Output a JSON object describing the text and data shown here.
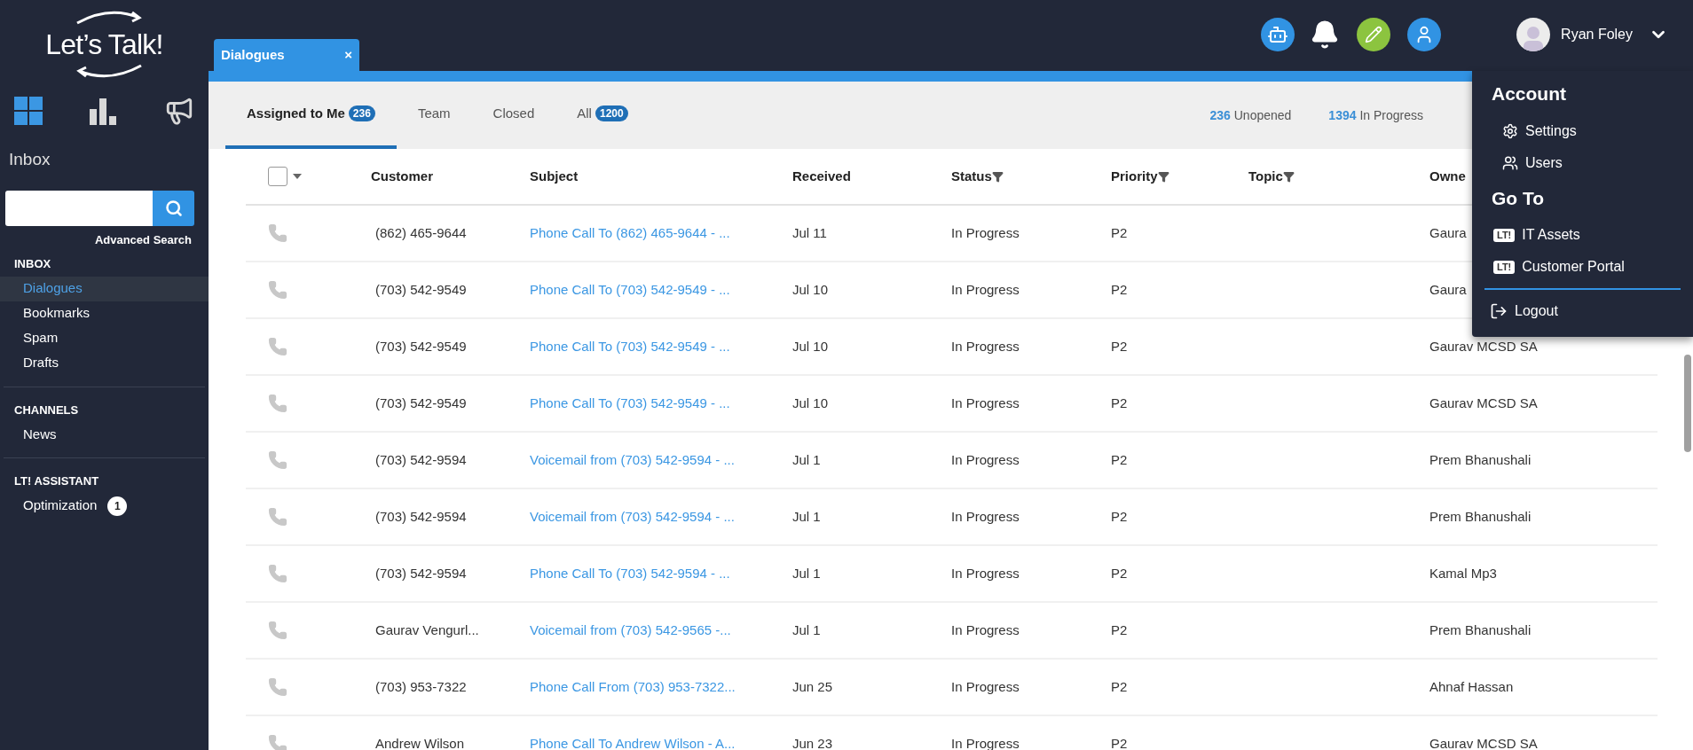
{
  "logo": {
    "text": "Let’s Talk!"
  },
  "nav_icons": [
    {
      "kind": "grid",
      "selected": true
    },
    {
      "kind": "chart",
      "selected": false
    },
    {
      "kind": "megaphone",
      "selected": false
    }
  ],
  "sidebar": {
    "title": "Inbox",
    "advanced_search": "Advanced Search",
    "sections": [
      {
        "heading": "INBOX",
        "items": [
          {
            "label": "Dialogues",
            "selected": true
          },
          {
            "label": "Bookmarks",
            "selected": false
          },
          {
            "label": "Spam",
            "selected": false
          },
          {
            "label": "Drafts",
            "selected": false
          }
        ]
      },
      {
        "heading": "CHANNELS",
        "items": [
          {
            "label": "News",
            "selected": false
          }
        ]
      },
      {
        "heading": "LT! ASSISTANT",
        "items": [
          {
            "label": "Optimization",
            "selected": false,
            "count": "1"
          }
        ]
      }
    ]
  },
  "user": {
    "name": "Ryan Foley"
  },
  "window_tab": {
    "title": "Dialogues",
    "close": "×"
  },
  "tabs": [
    {
      "label": "Assigned to Me",
      "count": "236",
      "selected": true
    },
    {
      "label": "Team",
      "selected": false
    },
    {
      "label": "Closed",
      "selected": false
    },
    {
      "label": "All",
      "count": "1200",
      "selected": false
    }
  ],
  "stats": [
    {
      "value": "236",
      "label": "Unopened"
    },
    {
      "value": "1394",
      "label": "In Progress"
    }
  ],
  "table": {
    "select_all": {
      "checked": false
    },
    "columns": [
      {
        "label": "Customer",
        "filter": false
      },
      {
        "label": "Subject",
        "filter": false
      },
      {
        "label": "Received",
        "filter": false
      },
      {
        "label": "Status",
        "filter": true
      },
      {
        "label": "Priority",
        "filter": true
      },
      {
        "label": "Topic",
        "filter": true
      },
      {
        "label": "Owne",
        "filter": false
      }
    ],
    "rows": [
      {
        "customer": "(862) 465-9644",
        "subject": "Phone Call To (862) 465-9644 - ...",
        "received": "Jul 11",
        "status": "In Progress",
        "priority": "P2",
        "owner": "Gaura"
      },
      {
        "customer": "(703) 542-9549",
        "subject": "Phone Call To (703) 542-9549 - ...",
        "received": "Jul 10",
        "status": "In Progress",
        "priority": "P2",
        "owner": "Gaura"
      },
      {
        "customer": "(703) 542-9549",
        "subject": "Phone Call To (703) 542-9549 - ...",
        "received": "Jul 10",
        "status": "In Progress",
        "priority": "P2",
        "owner": "Gaurav MCSD SA"
      },
      {
        "customer": "(703) 542-9549",
        "subject": "Phone Call To (703) 542-9549 - ...",
        "received": "Jul 10",
        "status": "In Progress",
        "priority": "P2",
        "owner": "Gaurav MCSD SA"
      },
      {
        "customer": "(703) 542-9594",
        "subject": "Voicemail from (703) 542-9594 - ...",
        "received": "Jul 1",
        "status": "In Progress",
        "priority": "P2",
        "owner": "Prem Bhanushali"
      },
      {
        "customer": "(703) 542-9594",
        "subject": "Voicemail from (703) 542-9594 - ...",
        "received": "Jul 1",
        "status": "In Progress",
        "priority": "P2",
        "owner": "Prem Bhanushali"
      },
      {
        "customer": "(703) 542-9594",
        "subject": "Phone Call To (703) 542-9594 - ...",
        "received": "Jul 1",
        "status": "In Progress",
        "priority": "P2",
        "owner": "Kamal Mp3"
      },
      {
        "customer": "Gaurav Vengurl...",
        "subject": "Voicemail from (703) 542-9565 -...",
        "received": "Jul 1",
        "status": "In Progress",
        "priority": "P2",
        "owner": "Prem Bhanushali"
      },
      {
        "customer": "(703) 953-7322",
        "subject": "Phone Call From (703) 953-7322...",
        "received": "Jun 25",
        "status": "In Progress",
        "priority": "P2",
        "owner": "Ahnaf Hassan"
      },
      {
        "customer": "Andrew Wilson",
        "subject": "Phone Call To Andrew Wilson - A...",
        "received": "Jun 23",
        "status": "In Progress",
        "priority": "P2",
        "owner": "Gaurav MCSD SA"
      }
    ]
  },
  "account_menu": {
    "sections": [
      {
        "heading": "Account",
        "items": [
          {
            "kind": "settings",
            "label": "Settings"
          },
          {
            "kind": "users",
            "label": "Users"
          }
        ]
      },
      {
        "heading": "Go To",
        "items": [
          {
            "kind": "app",
            "badge": "LT!",
            "label": "IT Assets"
          },
          {
            "kind": "app",
            "badge": "LT!",
            "label": "Customer Portal"
          }
        ]
      }
    ],
    "logout": {
      "label": "Logout"
    }
  }
}
